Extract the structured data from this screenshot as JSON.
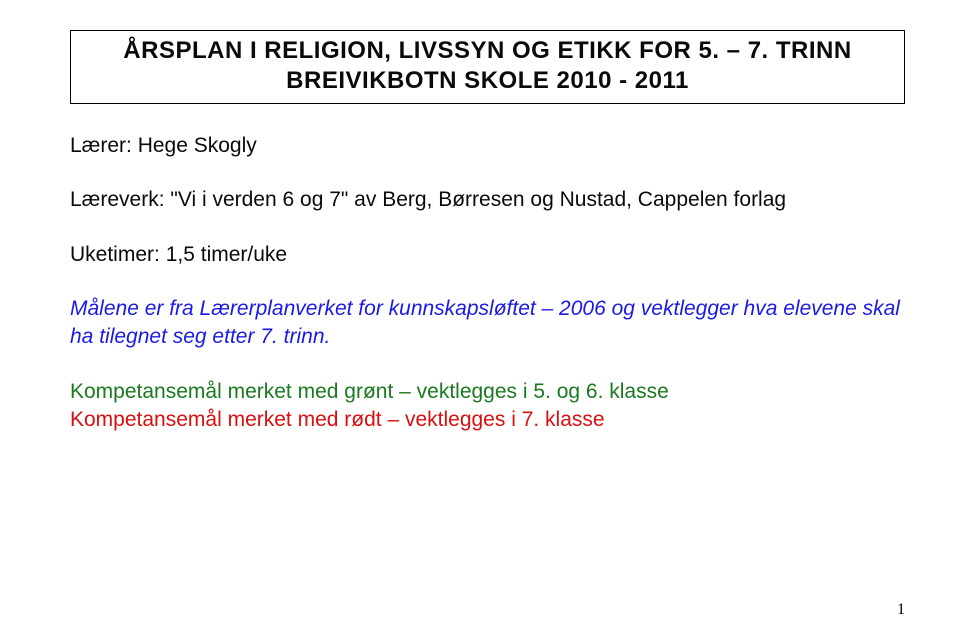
{
  "title": {
    "line1": "ÅRSPLAN I RELIGION, LIVSSYN OG ETIKK FOR 5. – 7. TRINN",
    "line2": "BREIVIKBOTN SKOLE 2010 - 2011"
  },
  "teacher": {
    "label": "Lærer:",
    "value": "Hege Skogly"
  },
  "textbook": {
    "label": "Læreverk:",
    "value": "\"Vi i verden 6 og 7\" av Berg, Børresen og Nustad, Cappelen forlag"
  },
  "hours": {
    "label": "Uketimer:",
    "value": "1,5 timer/uke"
  },
  "goals_note": {
    "prefix": "Målene er fra Lærerplanverket for kunnskapsløftet – 2006 og vektlegger hva elevene skal ha tilegnet seg etter 7. trinn."
  },
  "legend": {
    "green": "Kompetansemål merket med grønt – vektlegges i 5. og 6. klasse",
    "red": "Kompetansemål merket med rødt – vektlegges i 7. klasse"
  },
  "page_number": "1"
}
